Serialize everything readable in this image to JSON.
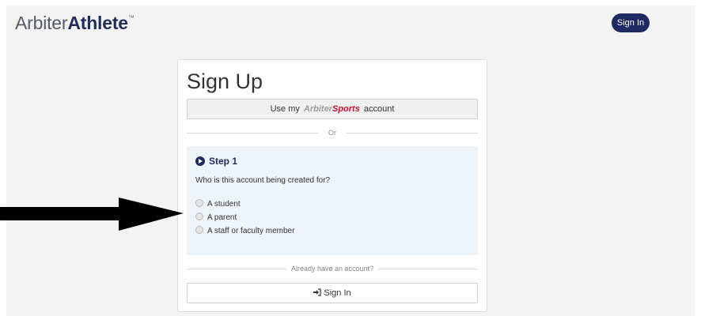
{
  "header": {
    "logo_part1": "Arbiter",
    "logo_part2": "Athlete",
    "logo_tm": "™",
    "sign_in_label": "Sign In"
  },
  "card": {
    "title": "Sign Up",
    "arbiter_button": {
      "prefix": "Use my",
      "brand_part1": "Arbiter",
      "brand_part2": "Sports",
      "suffix": "account"
    },
    "or_divider": "Or",
    "step": {
      "title": "Step 1",
      "question": "Who is this account being created for?",
      "options": [
        "A student",
        "A parent",
        "A staff or faculty member"
      ]
    },
    "already_divider": "Already have an account?",
    "sign_in_label": "Sign In"
  },
  "colors": {
    "brand_navy": "#1f2a63",
    "panel_blue": "#eef4fa",
    "page_bg": "#f3f3f3",
    "arbiter_red": "#c8102e"
  },
  "icons": {
    "step": "chevron-circle-right-icon",
    "sign_in": "sign-in-icon",
    "annotation": "arrow-pointer"
  }
}
